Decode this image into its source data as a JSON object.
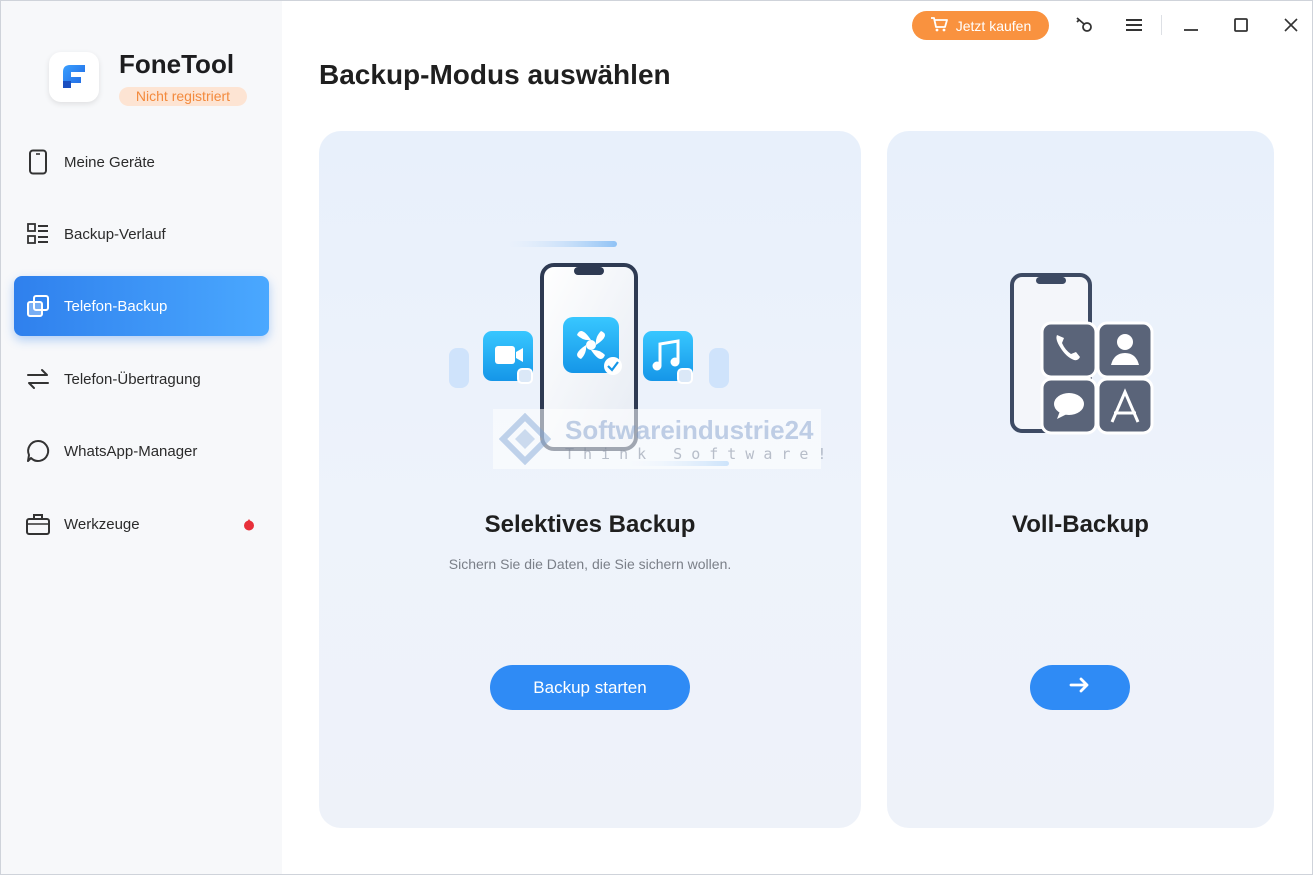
{
  "app": {
    "name": "FoneTool",
    "registration_status": "Nicht registriert"
  },
  "titlebar": {
    "buy_label": "Jetzt kaufen",
    "icons": [
      "key-icon",
      "menu-icon",
      "minimize-icon",
      "maximize-icon",
      "close-icon"
    ]
  },
  "sidebar": {
    "items": [
      {
        "label": "Meine Geräte",
        "icon": "phone-icon",
        "active": false
      },
      {
        "label": "Backup-Verlauf",
        "icon": "list-icon",
        "active": false
      },
      {
        "label": "Telefon-Backup",
        "icon": "copy-icon",
        "active": true
      },
      {
        "label": "Telefon-Übertragung",
        "icon": "transfer-icon",
        "active": false
      },
      {
        "label": "WhatsApp-Manager",
        "icon": "chat-bubble-icon",
        "active": false
      },
      {
        "label": "Werkzeuge",
        "icon": "briefcase-icon",
        "active": false,
        "badge": "red-dot"
      }
    ]
  },
  "main": {
    "title": "Backup-Modus auswählen",
    "cards": [
      {
        "title": "Selektives Backup",
        "subtitle": "Sichern Sie die Daten, die Sie sichern wollen.",
        "button_label": "Backup starten"
      },
      {
        "title": "Voll-Backup",
        "button_label": "→"
      }
    ]
  },
  "watermark": {
    "name": "Softwareindustrie24",
    "tagline": "Think Software!"
  },
  "colors": {
    "accent": "#2f8bf5",
    "buy": "#f9923f",
    "badge_text": "#f38a3d",
    "card_bg": "#eaf1fb"
  }
}
